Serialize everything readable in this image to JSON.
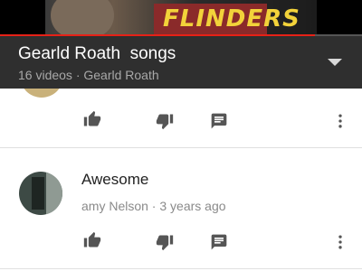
{
  "video": {
    "poster_text": "FLINDERS",
    "progress": 0.87
  },
  "playlist": {
    "title": "Gearld Roath  songs",
    "subtitle": "16 videos · Gearld Roath",
    "toggle_icon": "chevron-down-icon"
  },
  "comments": [
    {
      "text": "",
      "meta": "",
      "partial": true,
      "actions": [
        "thumb-up-icon",
        "thumb-down-icon",
        "reply-icon",
        "more-vert-icon"
      ]
    },
    {
      "text": "Awesome",
      "author": "amy Nelson",
      "age": "3 years ago",
      "meta": "amy Nelson · 3 years ago",
      "actions": [
        "thumb-up-icon",
        "thumb-down-icon",
        "reply-icon",
        "more-vert-icon"
      ]
    }
  ],
  "colors": {
    "header_bg": "#2f2f2f",
    "header_text": "#ffffff",
    "header_subtext": "#a8a8a8",
    "icon": "#555555",
    "progress": "#e62117"
  }
}
